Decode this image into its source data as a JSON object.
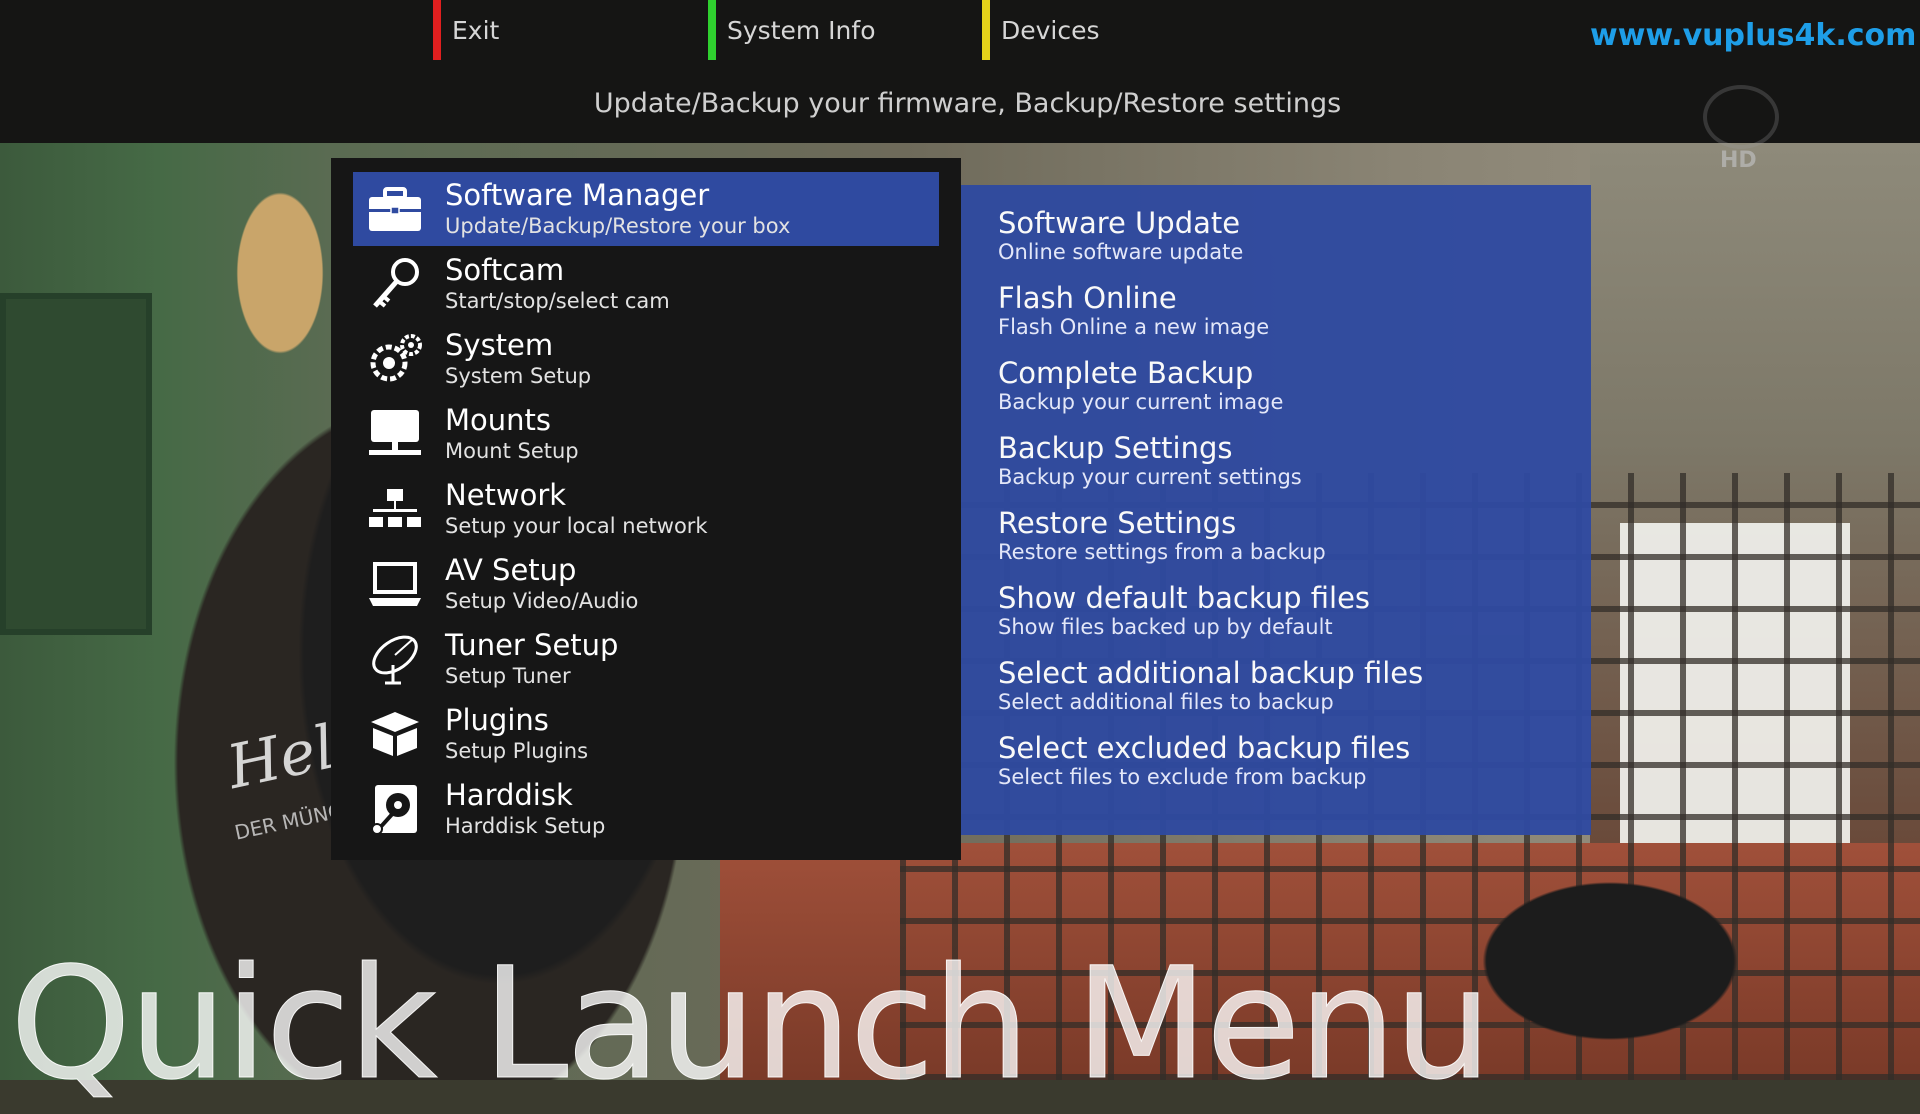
{
  "header": {
    "keys": [
      {
        "label": "Exit",
        "color": "#e11f1f"
      },
      {
        "label": "System Info",
        "color": "#2fd02f"
      },
      {
        "label": "Devices",
        "color": "#e6d21a"
      }
    ],
    "site": "www.vuplus4k.com",
    "subtitle": "Update/Backup your firmware, Backup/Restore settings",
    "channel_badge": "HD"
  },
  "background": {
    "shirt_text": "Hellabrunn",
    "shirt_sub": "DER MÜNCHNER TIERPARK"
  },
  "menu": {
    "items": [
      {
        "title": "Software Manager",
        "desc": "Update/Backup/Restore your box",
        "icon": "toolbox-icon",
        "selected": true
      },
      {
        "title": "Softcam",
        "desc": "Start/stop/select cam",
        "icon": "key-icon",
        "selected": false
      },
      {
        "title": "System",
        "desc": "System Setup",
        "icon": "gears-icon",
        "selected": false
      },
      {
        "title": "Mounts",
        "desc": "Mount Setup",
        "icon": "network-drive-icon",
        "selected": false
      },
      {
        "title": "Network",
        "desc": "Setup your local network",
        "icon": "network-icon",
        "selected": false
      },
      {
        "title": "AV Setup",
        "desc": "Setup Video/Audio",
        "icon": "laptop-icon",
        "selected": false
      },
      {
        "title": "Tuner Setup",
        "desc": "Setup Tuner",
        "icon": "satellite-dish-icon",
        "selected": false
      },
      {
        "title": "Plugins",
        "desc": "Setup Plugins",
        "icon": "package-icon",
        "selected": false
      },
      {
        "title": "Harddisk",
        "desc": "Harddisk Setup",
        "icon": "harddisk-icon",
        "selected": false
      }
    ]
  },
  "submenu": {
    "items": [
      {
        "title": "Software Update",
        "desc": "Online software update"
      },
      {
        "title": "Flash Online",
        "desc": "Flash Online a new image"
      },
      {
        "title": "Complete Backup",
        "desc": "Backup your current image"
      },
      {
        "title": "Backup Settings",
        "desc": "Backup your current settings"
      },
      {
        "title": "Restore Settings",
        "desc": "Restore settings from a backup"
      },
      {
        "title": "Show default backup files",
        "desc": "Show files backed up by default"
      },
      {
        "title": "Select additional backup files",
        "desc": "Select additional files to backup"
      },
      {
        "title": "Select excluded backup files",
        "desc": "Select files to exclude from backup"
      }
    ]
  },
  "footer": {
    "title": "Quick Launch Menu"
  }
}
